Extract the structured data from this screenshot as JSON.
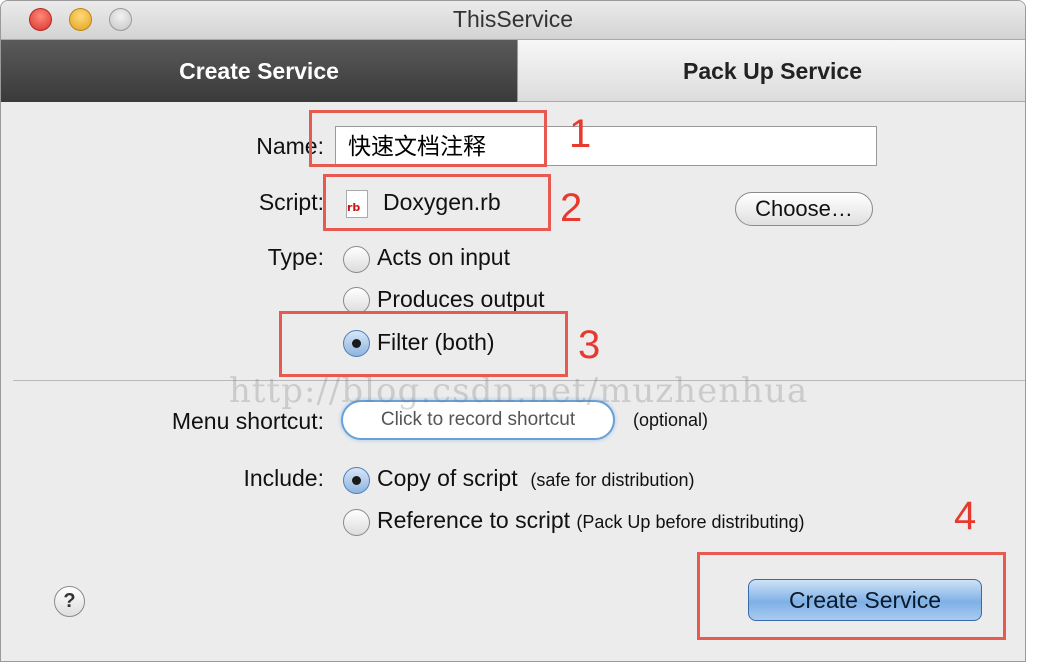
{
  "window": {
    "title": "ThisService"
  },
  "tabs": [
    {
      "label": "Create Service",
      "active": true
    },
    {
      "label": "Pack Up Service",
      "active": false
    }
  ],
  "form": {
    "name_label": "Name:",
    "name_value": "快速文档注释",
    "script_label": "Script:",
    "script_file": "Doxygen.rb",
    "script_file_tag": "rb",
    "choose_button": "Choose…",
    "type_label": "Type:",
    "type_options": [
      {
        "label": "Acts on input",
        "selected": false
      },
      {
        "label": "Produces output",
        "selected": false
      },
      {
        "label": "Filter (both)",
        "selected": true
      }
    ],
    "menu_shortcut_label": "Menu shortcut:",
    "shortcut_placeholder": "Click to record shortcut",
    "optional_text": "(optional)",
    "include_label": "Include:",
    "include_options": [
      {
        "label": "Copy of script",
        "note": "(safe for distribution)",
        "selected": true
      },
      {
        "label": "Reference to script",
        "note": "(Pack Up before distributing)",
        "selected": false
      }
    ]
  },
  "footer": {
    "help_label": "?",
    "create_button": "Create Service"
  },
  "annotations": [
    "1",
    "2",
    "3",
    "4"
  ],
  "watermark": "http://blog.csdn.net/muzhenhua",
  "colors": {
    "annotation": "#e8392f",
    "primary_button": "#7fb0e6",
    "active_tab": "#3a3a3a"
  }
}
